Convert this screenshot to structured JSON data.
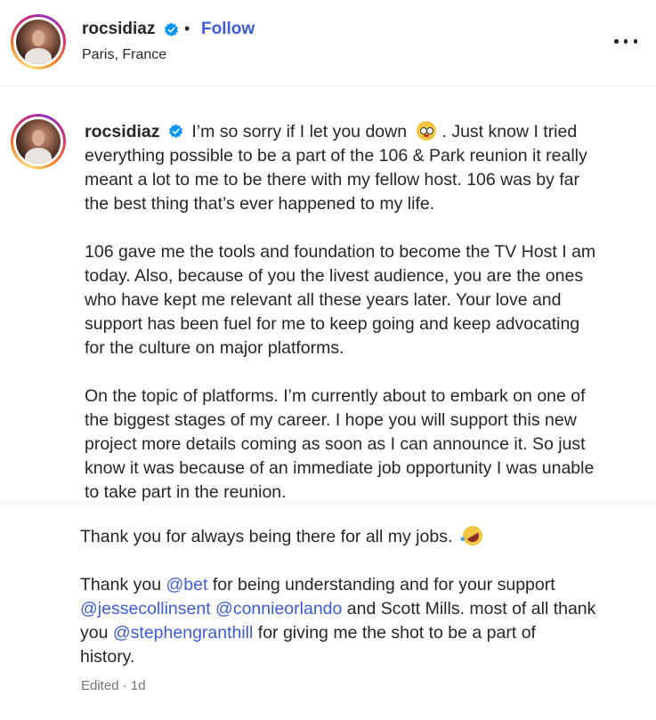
{
  "header": {
    "username": "rocsidiaz",
    "separator": "•",
    "follow_label": "Follow",
    "location": "Paris, France",
    "more_icon": "more-horizontal-icon"
  },
  "caption": {
    "username": "rocsidiaz",
    "lines": [
      "I’m so sorry if I let you down",
      ". Just know I tried",
      "everything possible to be a part of the 106 & Park reunion it really",
      "meant a lot to me to be there with my fellow host. 106 was by far",
      "the best thing that’s ever happened to my life.",
      "106 gave me the tools and foundation to become the TV Host I am",
      "today. Also, because of you the livest audience, you are the ones",
      "who have kept me relevant all these years later. Your love and",
      "support has been fuel for me to keep going and keep advocating",
      "for the culture on major platforms.",
      "On the topic of platforms. I’m currently about to embark on one of",
      "the biggest stages of my career. I hope you will support this new",
      "project more details coming as soon as I can announce it. So just",
      "know it was because of an immediate job opportunity I was unable",
      "to take part in the reunion."
    ]
  },
  "lower": {
    "thanks_jobs": "Thank you for always being there for all my jobs.",
    "thank_you": "Thank you",
    "mention_bet": "@bet",
    "after_bet": "for being understanding and for your support",
    "mention_jesse": "@jessecollinsent",
    "mention_connie": "@connieorlando",
    "after_connie": "and Scott Mills. most of all thank",
    "you_word": "you",
    "mention_stephen": "@stephengranthill",
    "after_stephen": "for giving me the shot to be a part of",
    "history": "history."
  },
  "meta": {
    "edited": "Edited · 1d"
  },
  "colors": {
    "link": "#3b5bdb",
    "verified": "#0095f6",
    "muted": "#737373"
  }
}
